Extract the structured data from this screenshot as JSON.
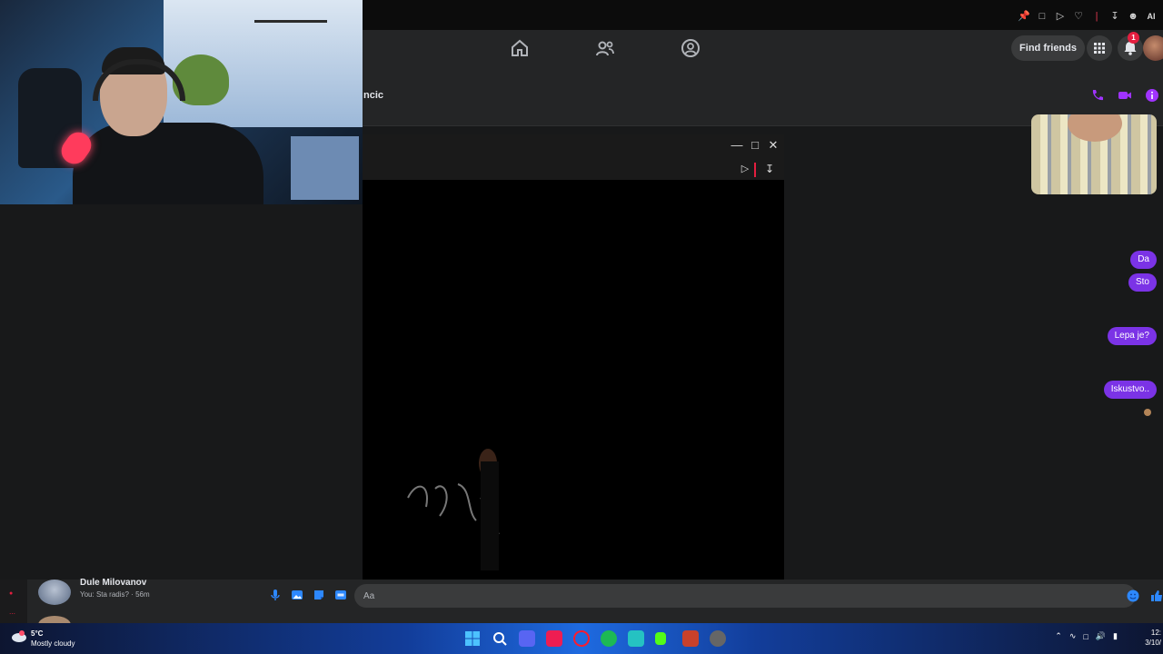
{
  "fb_nav": {
    "find_friends_label": "Find friends",
    "notification_count": "1",
    "tabs": [
      "home-icon",
      "friends-icon",
      "groups-icon"
    ]
  },
  "chat": {
    "contact_name_partial": "ncic",
    "header_icons": [
      "phone-icon",
      "video-call-icon",
      "info-icon"
    ],
    "accent_color": "#7b33e6",
    "messages": [
      {
        "text": "Da"
      },
      {
        "text": "Sto"
      },
      {
        "text": "Lepa je?"
      },
      {
        "text": "Iskustvo.."
      }
    ]
  },
  "viewer": {
    "controls": [
      "minimize-icon",
      "maximize-icon",
      "close-icon",
      "play-icon",
      "download-icon"
    ]
  },
  "conversation_list": {
    "items": [
      {
        "name": "Dule Milovanov",
        "preview": "You: Sta radis? · 56m"
      }
    ]
  },
  "composer": {
    "placeholder": "Aa",
    "icons": [
      "microphone-icon",
      "image-icon",
      "sticker-icon",
      "gif-icon",
      "like-icon"
    ]
  },
  "taskbar": {
    "weather_temp": "5°C",
    "weather_desc": "Mostly cloudy",
    "clock_time": "12:",
    "clock_date": "3/10/"
  }
}
